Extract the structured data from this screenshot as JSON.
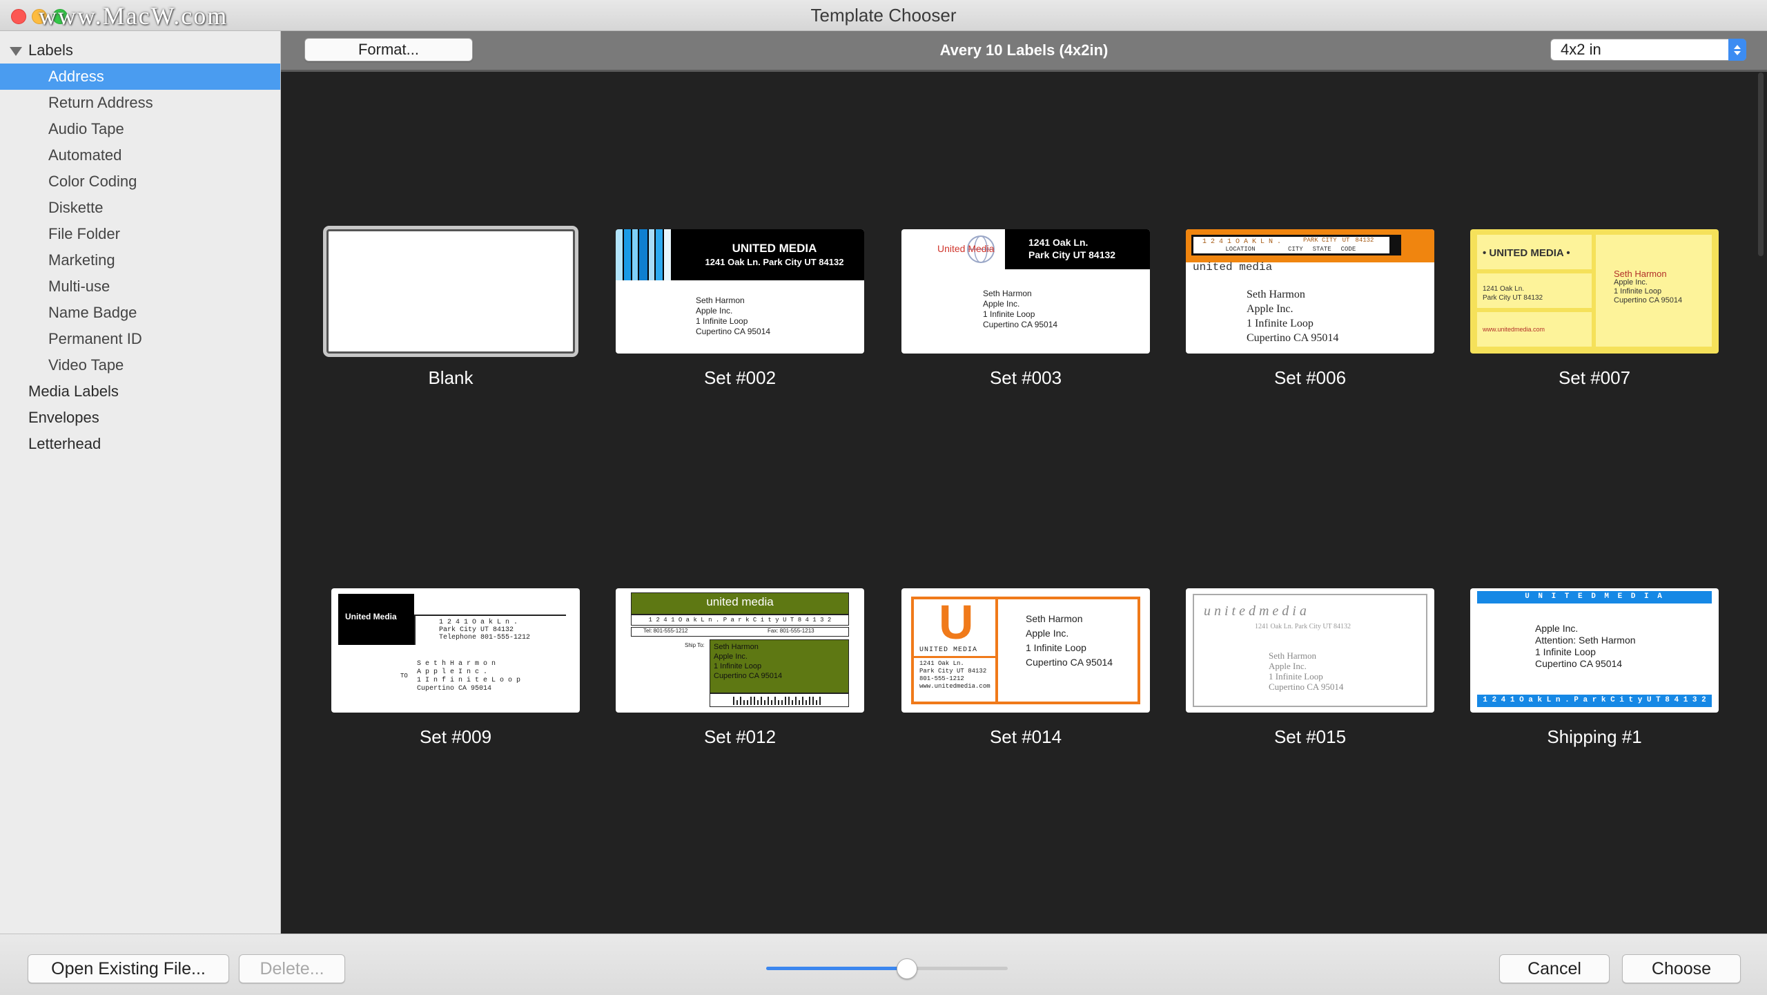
{
  "window": {
    "title": "Template Chooser",
    "watermark": "www.MacW.com"
  },
  "sidebar": {
    "items": [
      {
        "label": "Labels",
        "level": 0,
        "expanded": true
      },
      {
        "label": "Address",
        "level": 1,
        "selected": true
      },
      {
        "label": "Return Address",
        "level": 1
      },
      {
        "label": "Audio Tape",
        "level": 1
      },
      {
        "label": "Automated",
        "level": 1
      },
      {
        "label": "Color Coding",
        "level": 1
      },
      {
        "label": "Diskette",
        "level": 1
      },
      {
        "label": "File Folder",
        "level": 1
      },
      {
        "label": "Marketing",
        "level": 1
      },
      {
        "label": "Multi-use",
        "level": 1
      },
      {
        "label": "Name Badge",
        "level": 1
      },
      {
        "label": "Permanent ID",
        "level": 1
      },
      {
        "label": "Video Tape",
        "level": 1
      },
      {
        "label": "Media Labels",
        "level": 0
      },
      {
        "label": "Envelopes",
        "level": 0
      },
      {
        "label": "Letterhead",
        "level": 0
      }
    ]
  },
  "toolbar": {
    "format_label": "Format...",
    "label_format": "Avery 10 Labels (4x2in)",
    "size_value": "4x2 in"
  },
  "templates": [
    {
      "caption": "Blank"
    },
    {
      "caption": "Set #002",
      "brand": "UNITED MEDIA",
      "address": "1241 Oak Ln. Park City UT 84132",
      "recipient": [
        "Seth Harmon",
        "Apple Inc.",
        "1 Infinite Loop",
        "Cupertino CA 95014"
      ]
    },
    {
      "caption": "Set #003",
      "brand": "United Media",
      "address": [
        "1241 Oak Ln.",
        "Park City UT 84132"
      ],
      "recipient": [
        "Seth Harmon",
        "Apple Inc.",
        "1 Infinite Loop",
        "Cupertino CA 95014"
      ]
    },
    {
      "caption": "Set #006",
      "header": "1 2 4 1   O A K   L N .",
      "header_labels": [
        "LOCATION",
        "CITY",
        "STATE",
        "CODE"
      ],
      "header_values": [
        "PARK CITY",
        "UT",
        "84132"
      ],
      "brand": "united media",
      "recipient": [
        "Seth Harmon",
        "Apple Inc.",
        "1 Infinite Loop",
        "Cupertino CA 95014"
      ]
    },
    {
      "caption": "Set #007",
      "brand": "• UNITED MEDIA •",
      "address": [
        "1241 Oak Ln.",
        "Park City UT 84132"
      ],
      "web": "www.unitedmedia.com",
      "recipient": [
        "Seth Harmon",
        "Apple Inc.",
        "1 Infinite Loop",
        "Cupertino CA 95014"
      ]
    },
    {
      "caption": "Set #009",
      "brand": "United Media",
      "address": [
        "1 2 4 1   O a k   L n .",
        "Park City UT 84132",
        "Telephone 801-555-1212"
      ],
      "to": "TO",
      "recipient": [
        "S e t h   H a r m o n",
        "A p p l e   I n c .",
        "1  I n f i n i t e  L o o p",
        "Cupertino CA 95014"
      ]
    },
    {
      "caption": "Set #012",
      "brand": "united media",
      "address": "1 2 4 1   O a k   L n .   P a r k   C i t y   U T   8 4 1 3 2",
      "tel": "Tel: 801-555-1212",
      "fax": "Fax: 801-555-1213",
      "ship_to": "Ship To:",
      "recipient": [
        "Seth Harmon",
        "Apple Inc.",
        "1 Infinite Loop",
        "Cupertino CA 95014"
      ]
    },
    {
      "caption": "Set #014",
      "logo_letter": "U",
      "brand": "UNITED MEDIA",
      "address": [
        "1241 Oak Ln.",
        "Park City UT 84132",
        "801-555-1212",
        "www.unitedmedia.com"
      ],
      "recipient": [
        "Seth Harmon",
        "Apple Inc.",
        "1 Infinite Loop",
        "Cupertino CA 95014"
      ]
    },
    {
      "caption": "Set #015",
      "brand": "u n i t e d   m e d i a",
      "address": "1241 Oak Ln. Park City UT 84132",
      "recipient": [
        "Seth Harmon",
        "Apple Inc.",
        "1 Infinite Loop",
        "Cupertino CA 95014"
      ]
    },
    {
      "caption": "Shipping #1",
      "brand": "U N I T E D     M E D I A",
      "recipient": [
        "Apple Inc.",
        "Attention: Seth Harmon",
        "1 Infinite Loop",
        "Cupertino CA 95014"
      ],
      "address": "1 2 4 1   O a k   L n .   P a r k   C i t y   U T   8 4 1 3 2"
    }
  ],
  "footer": {
    "open_label": "Open Existing File...",
    "delete_label": "Delete...",
    "cancel_label": "Cancel",
    "choose_label": "Choose",
    "zoom_level": 0.58
  },
  "colors": {
    "selection": "#4a9cf0",
    "accent": "#3c8cf2",
    "orange": "#f0850f",
    "olive": "#5e7813",
    "blue": "#1688e5",
    "yellow": "#fdf39a",
    "red": "#d24a2d"
  }
}
